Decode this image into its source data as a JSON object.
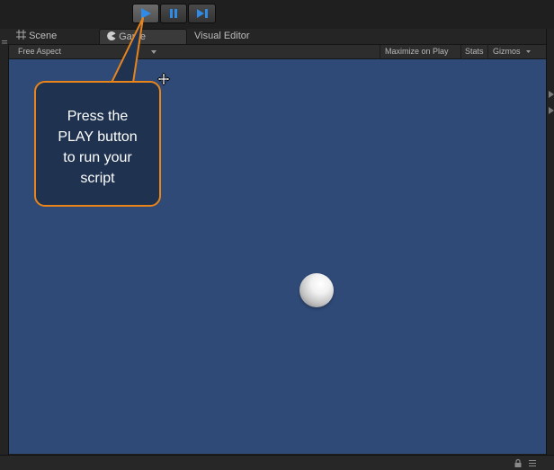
{
  "play_controls": {
    "play": "play-icon",
    "pause": "pause-icon",
    "step": "step-icon"
  },
  "tabs": [
    {
      "label": "Scene",
      "icon": "scene-grid-icon"
    },
    {
      "label": "Game",
      "icon": "game-pacman-icon",
      "active": true
    },
    {
      "label": "Visual Editor"
    }
  ],
  "game_toolbar": {
    "aspect": "Free Aspect",
    "maximize": "Maximize on Play",
    "stats": "Stats",
    "gizmos": "Gizmos"
  },
  "callout": {
    "lines": [
      "Press the",
      "PLAY button",
      "to run your",
      "script"
    ]
  },
  "colors": {
    "viewport_bg": "#304a78",
    "callout_border": "#e8841a",
    "callout_bg": "#1f3350",
    "play_icon": "#2f8be6"
  }
}
